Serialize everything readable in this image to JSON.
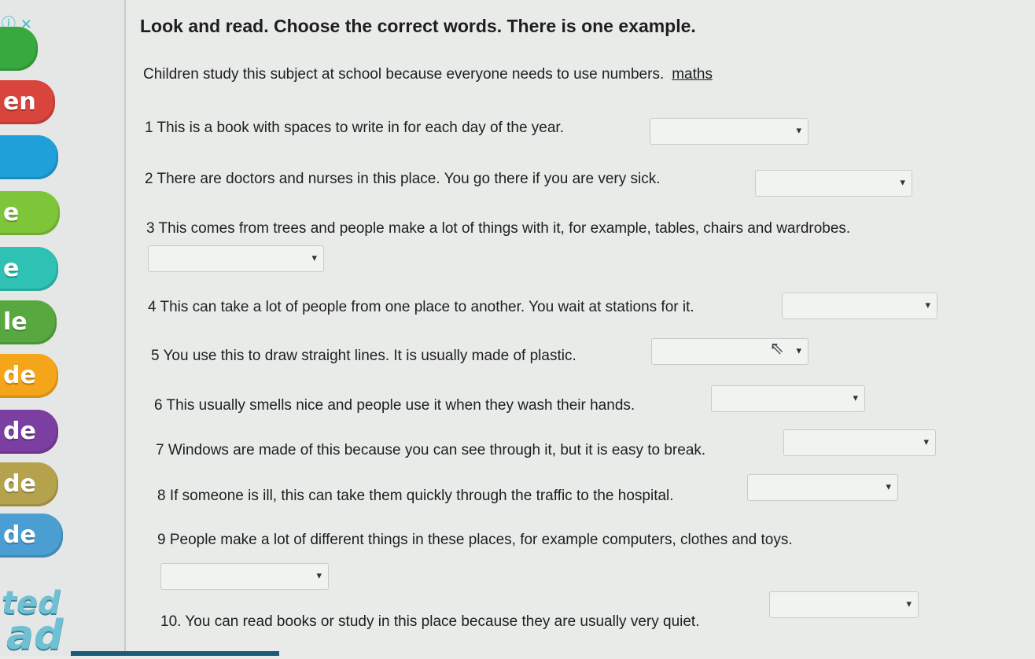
{
  "sidebar": {
    "top_icons": "ⓘ ×",
    "pills": [
      {
        "label": "",
        "color": "#38a93e"
      },
      {
        "label": "en",
        "color": "#d9453d"
      },
      {
        "label": "",
        "color": "#1fa0d8"
      },
      {
        "label": "e",
        "color": "#7fc53a"
      },
      {
        "label": "e",
        "color": "#2fc1b4"
      },
      {
        "label": "le",
        "color": "#57a83f"
      },
      {
        "label": "de",
        "color": "#f4a51a"
      },
      {
        "label": "de",
        "color": "#7b3fa1"
      },
      {
        "label": "de",
        "color": "#b5a24c"
      },
      {
        "label": "de",
        "color": "#4a9ed1"
      }
    ],
    "deco1": "ted",
    "deco2": "ad"
  },
  "task": {
    "heading": "Look and read. Choose the correct words. There is one example.",
    "example": {
      "text": "Children study this subject at school because everyone needs to use numbers.",
      "answer": "maths"
    },
    "questions": [
      {
        "text": "1 This is a book with spaces to write in for each day of the year.",
        "selected": ""
      },
      {
        "text": "2 There are doctors and nurses in this place. You go there if you are very sick.",
        "selected": ""
      },
      {
        "text": "3 This comes from trees and people make a lot of things with it, for example, tables, chairs and wardrobes.",
        "selected": ""
      },
      {
        "text": "4 This can take a lot of people from one place to another. You wait at stations for it.",
        "selected": ""
      },
      {
        "text": "5 You use this to draw straight lines. It is usually made of plastic.",
        "selected": ""
      },
      {
        "text": "6 This usually smells nice and people use it when they wash their hands.",
        "selected": ""
      },
      {
        "text": "7 Windows are made of this because you can see through it, but it is easy to break.",
        "selected": ""
      },
      {
        "text": "8 If someone is ill, this can take them quickly through the traffic to the hospital.",
        "selected": ""
      },
      {
        "text": "9  People make a lot of different things in these places, for example computers, clothes and toys.",
        "selected": ""
      },
      {
        "text": "10. You can read books or study in this place because they are usually very quiet.",
        "selected": ""
      }
    ]
  },
  "icons": {
    "dropdown": "chevron-down-icon",
    "cursor": "mouse-pointer-icon"
  }
}
